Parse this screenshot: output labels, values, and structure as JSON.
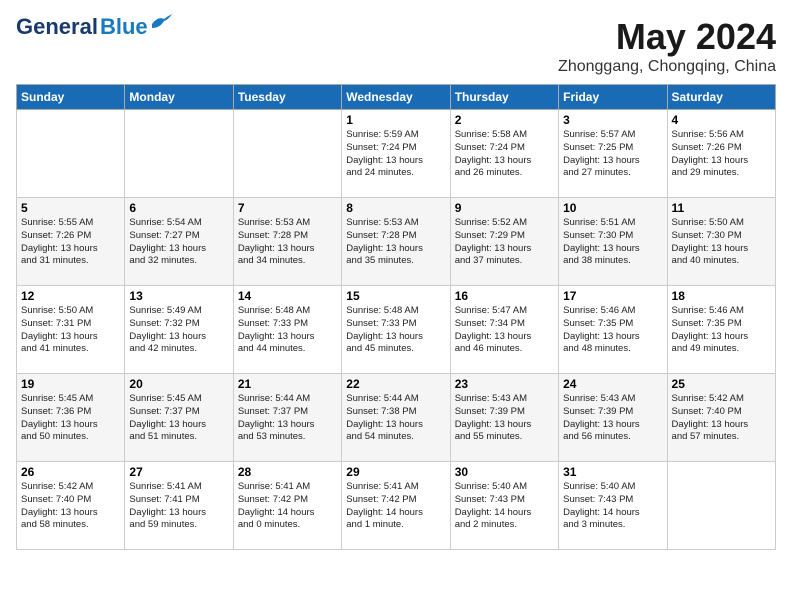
{
  "logo": {
    "line1": "General",
    "line2": "Blue"
  },
  "title": "May 2024",
  "location": "Zhonggang, Chongqing, China",
  "days_of_week": [
    "Sunday",
    "Monday",
    "Tuesday",
    "Wednesday",
    "Thursday",
    "Friday",
    "Saturday"
  ],
  "weeks": [
    [
      {
        "day": "",
        "info": ""
      },
      {
        "day": "",
        "info": ""
      },
      {
        "day": "",
        "info": ""
      },
      {
        "day": "1",
        "info": "Sunrise: 5:59 AM\nSunset: 7:24 PM\nDaylight: 13 hours\nand 24 minutes."
      },
      {
        "day": "2",
        "info": "Sunrise: 5:58 AM\nSunset: 7:24 PM\nDaylight: 13 hours\nand 26 minutes."
      },
      {
        "day": "3",
        "info": "Sunrise: 5:57 AM\nSunset: 7:25 PM\nDaylight: 13 hours\nand 27 minutes."
      },
      {
        "day": "4",
        "info": "Sunrise: 5:56 AM\nSunset: 7:26 PM\nDaylight: 13 hours\nand 29 minutes."
      }
    ],
    [
      {
        "day": "5",
        "info": "Sunrise: 5:55 AM\nSunset: 7:26 PM\nDaylight: 13 hours\nand 31 minutes."
      },
      {
        "day": "6",
        "info": "Sunrise: 5:54 AM\nSunset: 7:27 PM\nDaylight: 13 hours\nand 32 minutes."
      },
      {
        "day": "7",
        "info": "Sunrise: 5:53 AM\nSunset: 7:28 PM\nDaylight: 13 hours\nand 34 minutes."
      },
      {
        "day": "8",
        "info": "Sunrise: 5:53 AM\nSunset: 7:28 PM\nDaylight: 13 hours\nand 35 minutes."
      },
      {
        "day": "9",
        "info": "Sunrise: 5:52 AM\nSunset: 7:29 PM\nDaylight: 13 hours\nand 37 minutes."
      },
      {
        "day": "10",
        "info": "Sunrise: 5:51 AM\nSunset: 7:30 PM\nDaylight: 13 hours\nand 38 minutes."
      },
      {
        "day": "11",
        "info": "Sunrise: 5:50 AM\nSunset: 7:30 PM\nDaylight: 13 hours\nand 40 minutes."
      }
    ],
    [
      {
        "day": "12",
        "info": "Sunrise: 5:50 AM\nSunset: 7:31 PM\nDaylight: 13 hours\nand 41 minutes."
      },
      {
        "day": "13",
        "info": "Sunrise: 5:49 AM\nSunset: 7:32 PM\nDaylight: 13 hours\nand 42 minutes."
      },
      {
        "day": "14",
        "info": "Sunrise: 5:48 AM\nSunset: 7:33 PM\nDaylight: 13 hours\nand 44 minutes."
      },
      {
        "day": "15",
        "info": "Sunrise: 5:48 AM\nSunset: 7:33 PM\nDaylight: 13 hours\nand 45 minutes."
      },
      {
        "day": "16",
        "info": "Sunrise: 5:47 AM\nSunset: 7:34 PM\nDaylight: 13 hours\nand 46 minutes."
      },
      {
        "day": "17",
        "info": "Sunrise: 5:46 AM\nSunset: 7:35 PM\nDaylight: 13 hours\nand 48 minutes."
      },
      {
        "day": "18",
        "info": "Sunrise: 5:46 AM\nSunset: 7:35 PM\nDaylight: 13 hours\nand 49 minutes."
      }
    ],
    [
      {
        "day": "19",
        "info": "Sunrise: 5:45 AM\nSunset: 7:36 PM\nDaylight: 13 hours\nand 50 minutes."
      },
      {
        "day": "20",
        "info": "Sunrise: 5:45 AM\nSunset: 7:37 PM\nDaylight: 13 hours\nand 51 minutes."
      },
      {
        "day": "21",
        "info": "Sunrise: 5:44 AM\nSunset: 7:37 PM\nDaylight: 13 hours\nand 53 minutes."
      },
      {
        "day": "22",
        "info": "Sunrise: 5:44 AM\nSunset: 7:38 PM\nDaylight: 13 hours\nand 54 minutes."
      },
      {
        "day": "23",
        "info": "Sunrise: 5:43 AM\nSunset: 7:39 PM\nDaylight: 13 hours\nand 55 minutes."
      },
      {
        "day": "24",
        "info": "Sunrise: 5:43 AM\nSunset: 7:39 PM\nDaylight: 13 hours\nand 56 minutes."
      },
      {
        "day": "25",
        "info": "Sunrise: 5:42 AM\nSunset: 7:40 PM\nDaylight: 13 hours\nand 57 minutes."
      }
    ],
    [
      {
        "day": "26",
        "info": "Sunrise: 5:42 AM\nSunset: 7:40 PM\nDaylight: 13 hours\nand 58 minutes."
      },
      {
        "day": "27",
        "info": "Sunrise: 5:41 AM\nSunset: 7:41 PM\nDaylight: 13 hours\nand 59 minutes."
      },
      {
        "day": "28",
        "info": "Sunrise: 5:41 AM\nSunset: 7:42 PM\nDaylight: 14 hours\nand 0 minutes."
      },
      {
        "day": "29",
        "info": "Sunrise: 5:41 AM\nSunset: 7:42 PM\nDaylight: 14 hours\nand 1 minute."
      },
      {
        "day": "30",
        "info": "Sunrise: 5:40 AM\nSunset: 7:43 PM\nDaylight: 14 hours\nand 2 minutes."
      },
      {
        "day": "31",
        "info": "Sunrise: 5:40 AM\nSunset: 7:43 PM\nDaylight: 14 hours\nand 3 minutes."
      },
      {
        "day": "",
        "info": ""
      }
    ]
  ]
}
